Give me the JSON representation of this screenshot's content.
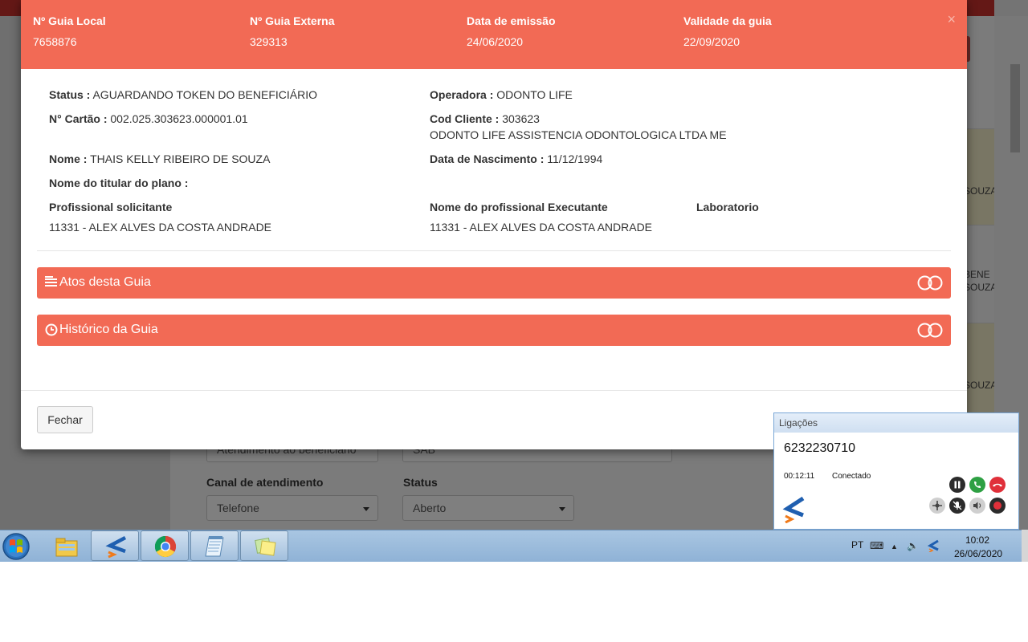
{
  "modal": {
    "header": {
      "guia_local_label": "Nº Guia Local",
      "guia_local_value": "7658876",
      "guia_externa_label": "Nº Guia Externa",
      "guia_externa_value": "329313",
      "emissao_label": "Data de emissão",
      "emissao_value": "24/06/2020",
      "validade_label": "Validade da guia",
      "validade_value": "22/09/2020",
      "close_glyph": "×"
    },
    "details": {
      "status_label": "Status :",
      "status_value": "AGUARDANDO TOKEN DO BENEFICIÁRIO",
      "operadora_label": "Operadora :",
      "operadora_value": "ODONTO LIFE",
      "cartao_label": "N° Cartão :",
      "cartao_value": "002.025.303623.000001.01",
      "cod_cliente_label": "Cod Cliente :",
      "cod_cliente_value": "303623",
      "cliente_nome": "ODONTO LIFE ASSISTENCIA ODONTOLOGICA LTDA ME",
      "nome_label": "Nome :",
      "nome_value": "THAIS KELLY RIBEIRO DE SOUZA",
      "nascimento_label": "Data de Nascimento :",
      "nascimento_value": "11/12/1994",
      "titular_label": "Nome do titular do plano :",
      "solicitante_label": "Profissional solicitante",
      "solicitante_value": "11331 - ALEX ALVES DA COSTA ANDRADE",
      "executante_label": "Nome do profissional Executante",
      "executante_value": "11331 - ALEX ALVES DA COSTA ANDRADE",
      "laboratorio_label": "Laboratorio"
    },
    "accordions": [
      {
        "label": "Atos desta Guia",
        "icon": "list-icon"
      },
      {
        "label": "Histórico da Guia",
        "icon": "clock-icon"
      }
    ],
    "footer": {
      "close_button": "Fechar"
    }
  },
  "background": {
    "canal_label": "Canal de atendimento",
    "canal_value": "Telefone",
    "status_label": "Status",
    "status_value": "Aberto",
    "partial_select_1": "Atendimento ao beneficiário",
    "partial_select_2": "SAB",
    "strip_1": "SOUZA",
    "strip_2a": "BENE",
    "strip_2b": "SOUZA",
    "strip_3": "SOUZA"
  },
  "calls_widget": {
    "title": "Ligações",
    "number": "6232230710",
    "duration": "00:12:11",
    "status": "Conectado",
    "colors": {
      "answer": "#2ea043",
      "hangup": "#e0303a",
      "dark": "#333333"
    }
  },
  "taskbar": {
    "language": "PT",
    "time": "10:02",
    "date": "26/06/2020"
  },
  "colors": {
    "accent": "#f26a55",
    "topbar": "#c9302c"
  }
}
